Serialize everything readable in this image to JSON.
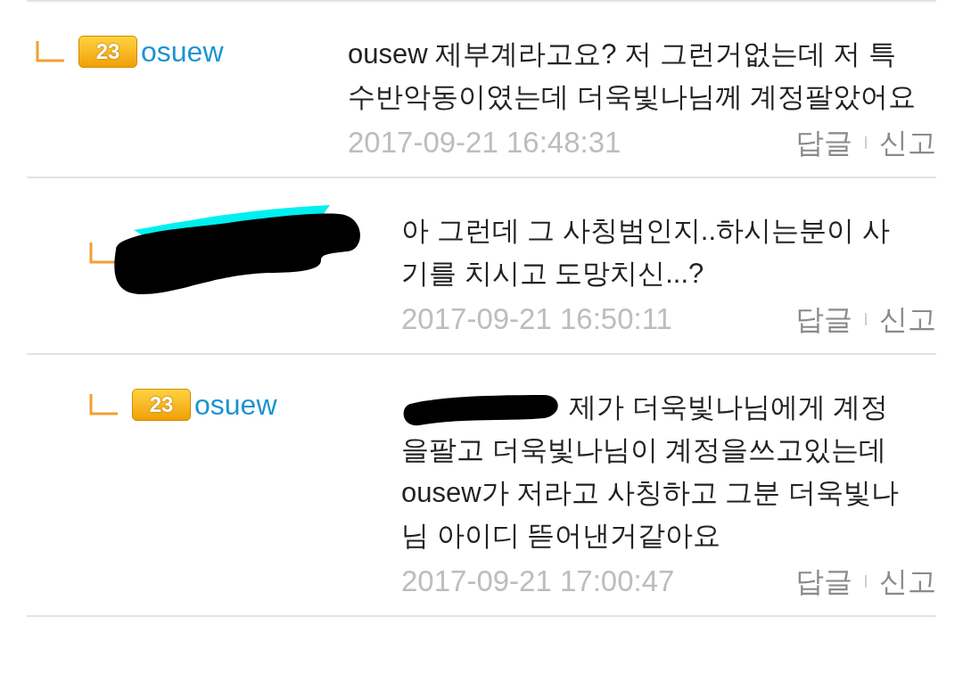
{
  "comments": [
    {
      "author": {
        "kind": "user",
        "level": "23",
        "name": "osuew"
      },
      "text": "ousew 제부계라고요? 저 그런거없는데 저 특수반악동이였는데 더욱빛나님께 계정팔았어요",
      "date": "2017-09-21 16:48:31",
      "actions": [
        "답글",
        "신고"
      ],
      "children": [
        {
          "author": {
            "kind": "redacted"
          },
          "text": "아 그런데 그 사칭범인지..하시는분이 사기를 치시고 도망치신...?",
          "date": "2017-09-21 16:50:11",
          "actions": [
            "답글",
            "신고"
          ]
        },
        {
          "author": {
            "kind": "user",
            "level": "23",
            "name": "osuew"
          },
          "text_redacted_prefix": true,
          "text": "제가 더욱빛나님에게 계정을팔고 더욱빛나님이 계정을쓰고있는데 ousew가 저라고 사칭하고 그분 더욱빛나님 아이디 뜯어낸거같아요",
          "date": "2017-09-21 17:00:47",
          "actions": [
            "답글",
            "신고"
          ]
        }
      ]
    }
  ]
}
